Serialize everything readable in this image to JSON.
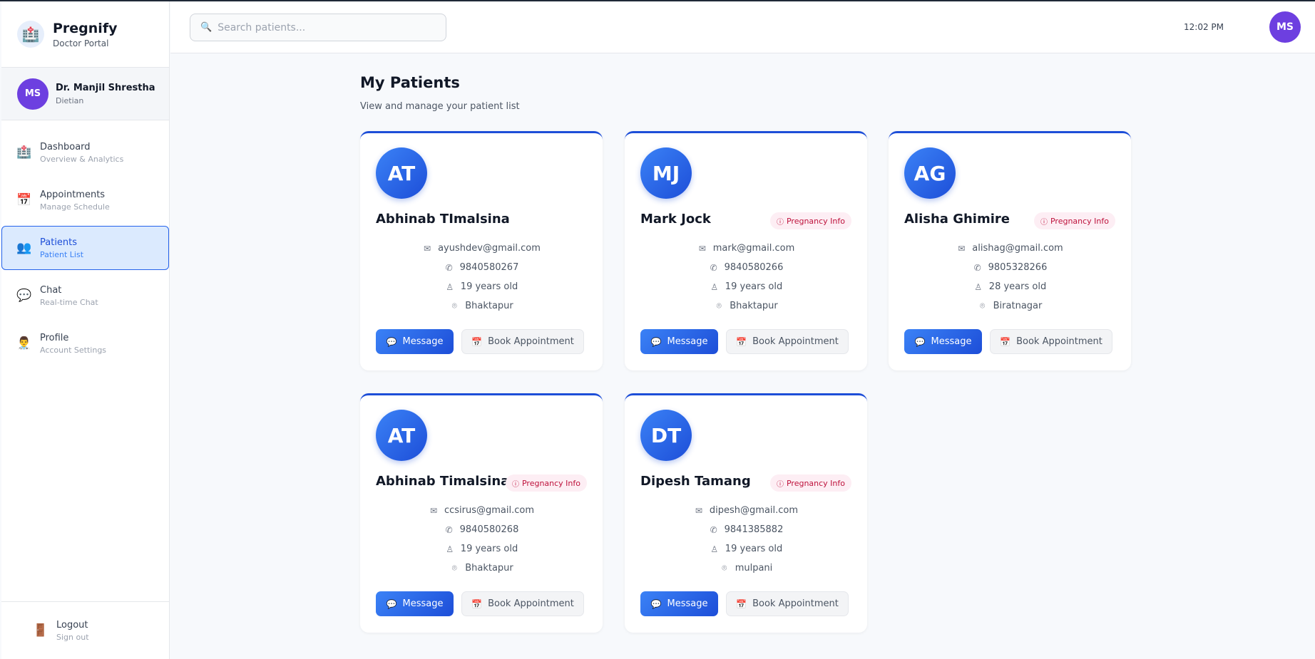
{
  "brand": {
    "name": "Pregnify",
    "subtitle": "Doctor Portal",
    "logo_icon": "hospital-icon"
  },
  "doctor": {
    "initials": "MS",
    "name": "Dr. Manjil Shrestha",
    "role": "Dietian"
  },
  "nav": [
    {
      "label": "Dashboard",
      "sub": "Overview & Analytics",
      "icon": "🏥",
      "active": false
    },
    {
      "label": "Appointments",
      "sub": "Manage Schedule",
      "icon": "📅",
      "active": false
    },
    {
      "label": "Patients",
      "sub": "Patient List",
      "icon": "👥",
      "active": true
    },
    {
      "label": "Chat",
      "sub": "Real-time Chat",
      "icon": "💬",
      "active": false
    },
    {
      "label": "Profile",
      "sub": "Account Settings",
      "icon": "👨‍⚕️",
      "active": false
    }
  ],
  "logout": {
    "label": "Logout",
    "sub": "Sign out",
    "icon": "🚪"
  },
  "search": {
    "placeholder": "Search patients...",
    "icon": "🔍"
  },
  "topbar": {
    "time": "12:02 PM",
    "user_initials": "MS"
  },
  "page": {
    "title": "My Patients",
    "subtitle": "View and manage your patient list"
  },
  "patients": [
    {
      "initials": "AT",
      "name": "Abhinab TImalsina",
      "badge": "",
      "email": "ayushdev@gmail.com",
      "phone": "9840580267",
      "age": "19 years old",
      "location": "Bhaktapur"
    },
    {
      "initials": "MJ",
      "name": "Mark Jock",
      "badge": "Pregnancy Info",
      "email": "mark@gmail.com",
      "phone": "9840580266",
      "age": "19 years old",
      "location": "Bhaktapur"
    },
    {
      "initials": "AG",
      "name": "Alisha Ghimire",
      "badge": "Pregnancy Info",
      "email": "alishag@gmail.com",
      "phone": "9805328266",
      "age": "28 years old",
      "location": "Biratnagar"
    },
    {
      "initials": "AT",
      "name": "Abhinab Timalsina",
      "badge": "Pregnancy Info",
      "email": "ccsirus@gmail.com",
      "phone": "9840580268",
      "age": "19 years old",
      "location": "Bhaktapur"
    },
    {
      "initials": "DT",
      "name": "Dipesh Tamang",
      "badge": "Pregnancy Info",
      "email": "dipesh@gmail.com",
      "phone": "9841385882",
      "age": "19 years old",
      "location": "mulpani"
    }
  ],
  "actions": {
    "message": "Message",
    "book": "Book Appointment"
  },
  "colors": {
    "accent": "#1d4ed8",
    "avatar": "#6d3fe0",
    "badge": "#be123c"
  }
}
